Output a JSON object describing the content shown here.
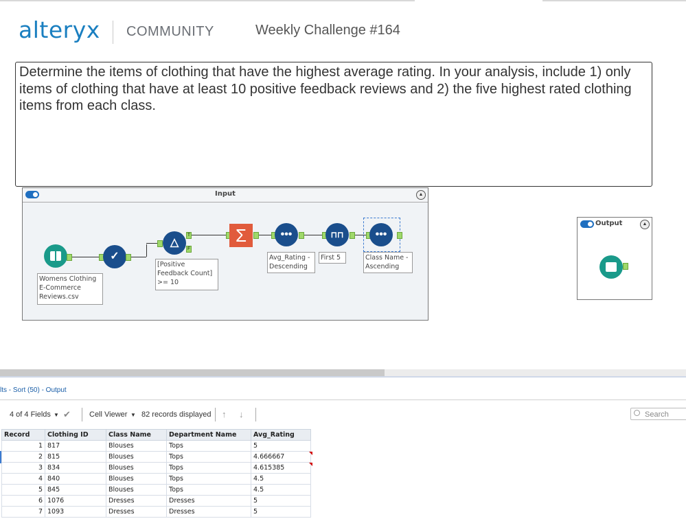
{
  "header": {
    "logo": "alteryx",
    "community": "COMMUNITY",
    "challenge": "Weekly Challenge #164"
  },
  "description": "Determine the items of clothing that have the highest average rating.  In your analysis, include 1) only items of clothing that have at least 10 positive feedback reviews and  2) the five highest rated clothing items from each class.",
  "workflow": {
    "input_container_title": "Input",
    "output_container_title": "Output",
    "annotations": {
      "input_file": "Womens Clothing\nE-Commerce\nReviews.csv",
      "filter": "[Positive\nFeedback Count]\n>= 10",
      "sort1": "Avg_Rating -\nDescending",
      "sample": "First 5",
      "sort2": "Class Name -\nAscending"
    },
    "filter_anchors": {
      "true": "T",
      "false": "F"
    },
    "colors": {
      "tool_blue": "#1a4e8c",
      "summarize": "#e15b3c",
      "input_teal": "#1a9a8a",
      "anchor_green": "#9fd86a"
    }
  },
  "results": {
    "title": "lts - Sort (50) - Output",
    "fields": "4 of 4 Fields",
    "cell_viewer": "Cell Viewer",
    "records_displayed": "82 records displayed",
    "search_placeholder": "Search",
    "columns": [
      "Record",
      "Clothing ID",
      "Class Name",
      "Department Name",
      "Avg_Rating"
    ],
    "rows": [
      [
        "1",
        "817",
        "Blouses",
        "Tops",
        "5"
      ],
      [
        "2",
        "815",
        "Blouses",
        "Tops",
        "4.666667"
      ],
      [
        "3",
        "834",
        "Blouses",
        "Tops",
        "4.615385"
      ],
      [
        "4",
        "840",
        "Blouses",
        "Tops",
        "4.5"
      ],
      [
        "5",
        "845",
        "Blouses",
        "Tops",
        "4.5"
      ],
      [
        "6",
        "1076",
        "Dresses",
        "Dresses",
        "5"
      ],
      [
        "7",
        "1093",
        "Dresses",
        "Dresses",
        "5"
      ]
    ]
  }
}
